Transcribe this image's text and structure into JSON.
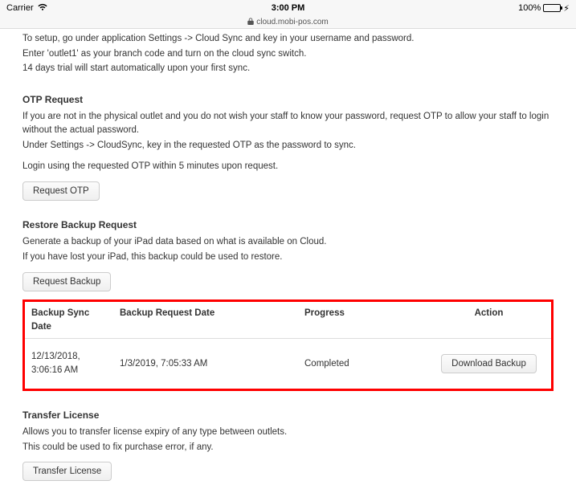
{
  "status": {
    "carrier": "Carrier",
    "time": "3:00 PM",
    "battery_pct": "100%"
  },
  "url": "cloud.mobi-pos.com",
  "intro": {
    "line1": "To setup, go under application Settings -> Cloud Sync and key in your username and password.",
    "line2": "Enter 'outlet1' as your branch code and turn on the cloud sync switch.",
    "line3": "14 days trial will start automatically upon your first sync."
  },
  "otp": {
    "heading": "OTP Request",
    "line1": "If you are not in the physical outlet and you do not wish your staff to know your password, request OTP to allow your staff to login without the actual password.",
    "line2": "Under Settings -> CloudSync, key in the requested OTP as the password to sync.",
    "line3": "Login using the requested OTP within 5 minutes upon request.",
    "button": "Request OTP"
  },
  "restore": {
    "heading": "Restore Backup Request",
    "line1": "Generate a backup of your iPad data based on what is available on Cloud.",
    "line2": "If you have lost your iPad, this backup could be used to restore.",
    "button": "Request Backup",
    "table": {
      "headers": {
        "c1": "Backup Sync Date",
        "c2": "Backup Request Date",
        "c3": "Progress",
        "c4": "Action"
      },
      "row": {
        "sync_date": "12/13/2018, 3:06:16 AM",
        "request_date": "1/3/2019, 7:05:33 AM",
        "progress": "Completed",
        "action_label": "Download Backup"
      }
    }
  },
  "transfer": {
    "heading": "Transfer License",
    "line1": "Allows you to transfer license expiry of any type between outlets.",
    "line2": "This could be used to fix purchase error, if any.",
    "button": "Transfer License"
  }
}
